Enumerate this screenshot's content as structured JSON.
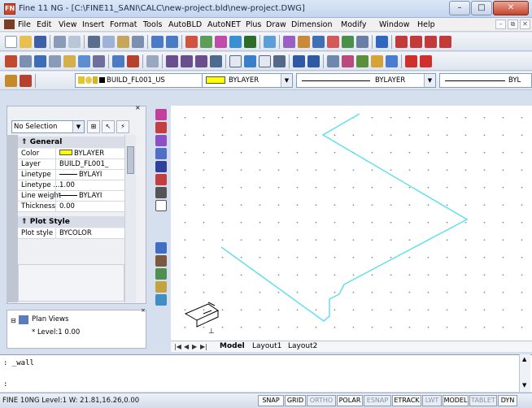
{
  "window": {
    "app_badge": "FN",
    "title": "Fine 11 NG - [C:\\FINE11_SANI\\CALC\\new-project.bld\\new-project.DWG]",
    "min": "–",
    "max": "□",
    "close": "✕"
  },
  "menu": [
    "File",
    "Edit",
    "View",
    "Insert",
    "Format",
    "Tools",
    "AutoBLD",
    "AutoNET",
    "Plus",
    "Draw",
    "Dimension",
    "Modify",
    "Window",
    "Help"
  ],
  "mdi": {
    "min": "–",
    "restore": "⧉",
    "close": "✕"
  },
  "layer_toolbar": {
    "layer_name": "BUILD_FL001_US",
    "color_value": "BYLAYER",
    "linetype_value": "BYLAYER",
    "lineweight_value": "BYL"
  },
  "properties": {
    "close": "×",
    "selection": "No Selection",
    "general_header": "General",
    "rows": [
      {
        "key": "Color",
        "value": "BYLAYER"
      },
      {
        "key": "Layer",
        "value": "BUILD_FL001_"
      },
      {
        "key": "Linetype",
        "value": "BYLAYI"
      },
      {
        "key": "Linetype ...",
        "value": "1.00"
      },
      {
        "key": "Line weight",
        "value": "BYLAYI"
      },
      {
        "key": "Thickness",
        "value": "0.00"
      }
    ],
    "plot_header": "Plot Style",
    "plot_rows": [
      {
        "key": "Plot style",
        "value": "BYCOLOR"
      }
    ]
  },
  "plan_views": {
    "root": "Plan Views",
    "child": "* Level:1  0.00"
  },
  "layout_tabs": [
    "Model",
    "Layout1",
    "Layout2"
  ],
  "command_line": [
    ": _wall",
    ":"
  ],
  "status": {
    "left": "FINE 10NG Level:1 W: 21.81,16.26,0.00",
    "buttons": [
      {
        "label": "SNAP",
        "on": true
      },
      {
        "label": "GRID",
        "on": true
      },
      {
        "label": "ORTHO",
        "on": false
      },
      {
        "label": "POLAR",
        "on": true
      },
      {
        "label": "ESNAP",
        "on": false
      },
      {
        "label": "ETRACK",
        "on": true
      },
      {
        "label": "LWT",
        "on": false
      },
      {
        "label": "MODEL",
        "on": true
      },
      {
        "label": "TABLET",
        "on": false
      },
      {
        "label": "DYN",
        "on": true
      }
    ]
  },
  "colors": {
    "wall_line": "#5fe0f0",
    "accent_red": "#d0482b"
  }
}
